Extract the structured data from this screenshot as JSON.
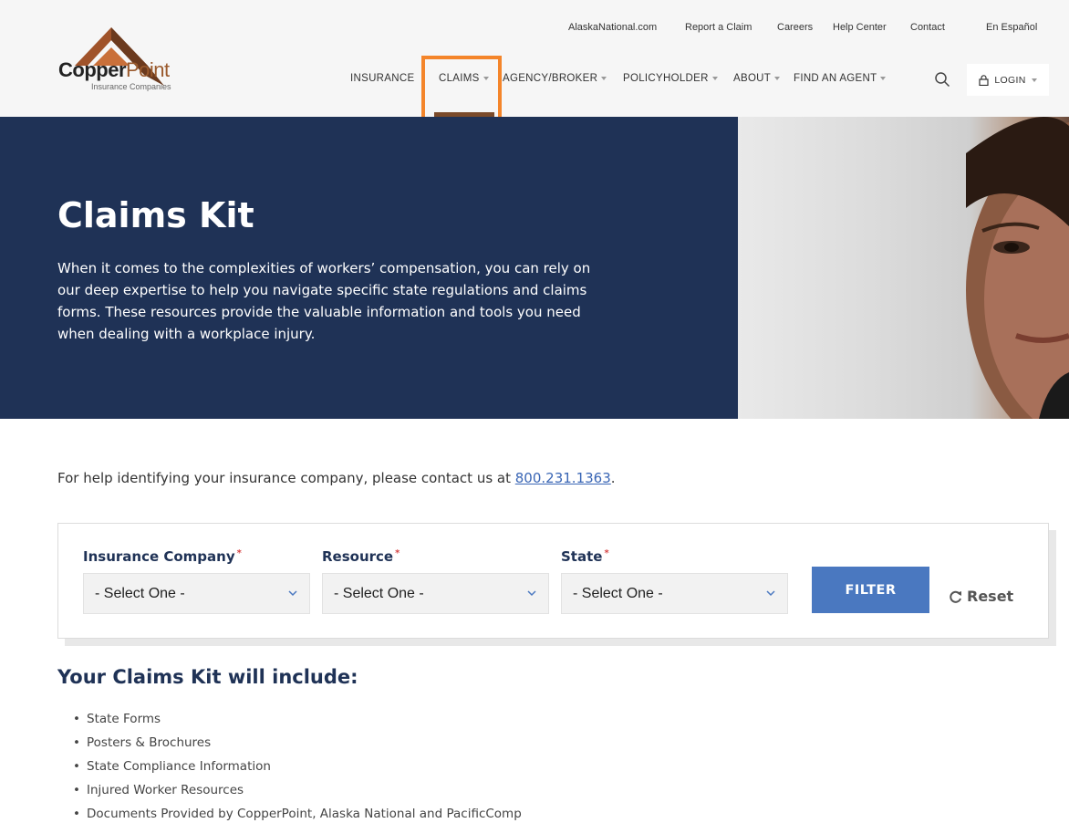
{
  "logo": {
    "brand_bold": "Copper",
    "brand_light": "Point",
    "subtitle": "Insurance Companies",
    "colors": {
      "peak": "#a0532a",
      "peak_dark": "#6b3a1e"
    }
  },
  "utility_nav": [
    "AlaskaNational.com",
    "Report a Claim",
    "Careers",
    "Help Center",
    "Contact",
    "En Español"
  ],
  "main_nav": [
    {
      "label": "INSURANCE",
      "has_dropdown": false
    },
    {
      "label": "CLAIMS",
      "has_dropdown": true,
      "active": true
    },
    {
      "label": "AGENCY/BROKER",
      "has_dropdown": true
    },
    {
      "label": "POLICYHOLDER",
      "has_dropdown": true
    },
    {
      "label": "ABOUT",
      "has_dropdown": true
    },
    {
      "label": "FIND AN AGENT",
      "has_dropdown": true
    }
  ],
  "header": {
    "search_icon": "search-icon",
    "login_label": "LOGIN",
    "login_icon": "lock-icon"
  },
  "hero": {
    "title": "Claims Kit",
    "text": "When it comes to the complexities of workers’ compensation, you can rely on our deep expertise to help you navigate specific state regulations and claims forms. These resources provide the valuable information and tools you need when dealing with a workplace injury.",
    "bg_color": "#1f3256"
  },
  "help": {
    "prefix": "For help identifying your insurance company, please contact us at ",
    "phone": "800.231.1363",
    "suffix": "."
  },
  "filter": {
    "fields": [
      {
        "label": "Insurance Company",
        "required_mark": "*",
        "value": "- Select One -"
      },
      {
        "label": "Resource",
        "required_mark": "*",
        "value": "- Select One -"
      },
      {
        "label": "State",
        "required_mark": "*",
        "value": "- Select One -"
      }
    ],
    "filter_button": "FILTER",
    "reset_label": "Reset",
    "accent": "#4a78c0",
    "highlight_color": "#f4852a"
  },
  "kit": {
    "title": "Your Claims Kit will include:",
    "items": [
      "State Forms",
      "Posters & Brochures",
      "State Compliance Information",
      "Injured Worker Resources",
      "Documents Provided by CopperPoint, Alaska National and PacificComp"
    ]
  }
}
